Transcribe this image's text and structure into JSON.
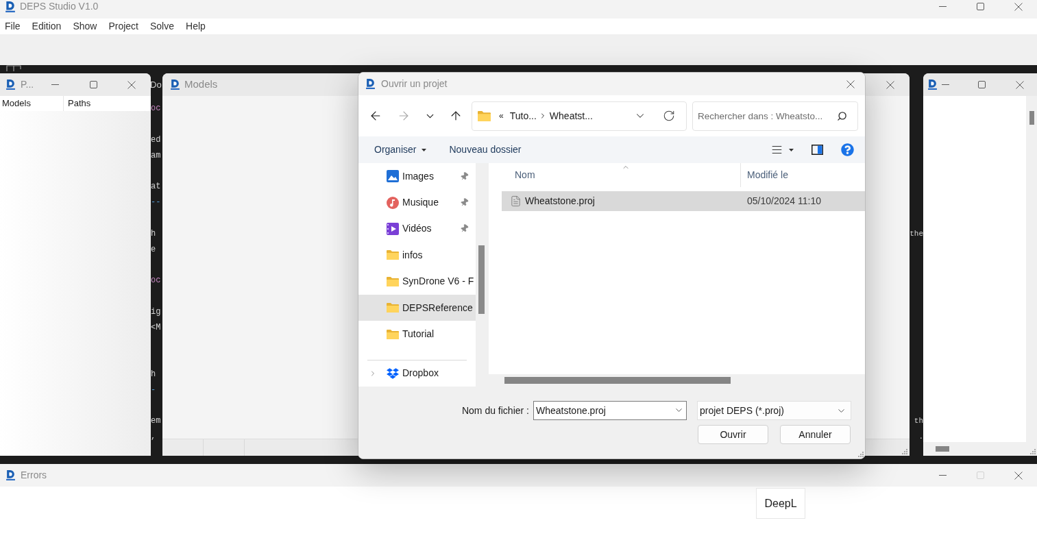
{
  "app_window": {
    "title": "DEPS Studio V1.0",
    "menu": [
      "File",
      "Edition",
      "Show",
      "Project",
      "Solve",
      "Help"
    ]
  },
  "editor": {
    "title": "Do",
    "lines": [
      {
        "kind": "code",
        "left": "oc",
        "color": "#c586c0"
      },
      {
        "kind": "blank"
      },
      {
        "kind": "code",
        "left": "ed"
      },
      {
        "kind": "code",
        "left": "am"
      },
      {
        "kind": "blank"
      },
      {
        "kind": "code",
        "left": "at"
      },
      {
        "kind": "code",
        "left": "--",
        "color": "#569cd6"
      },
      {
        "kind": "blank"
      },
      {
        "kind": "code",
        "left": "h",
        "right": "the"
      },
      {
        "kind": "code",
        "left": "e"
      },
      {
        "kind": "blank"
      },
      {
        "kind": "code",
        "left": "oc",
        "color": "#c586c0"
      },
      {
        "kind": "blank"
      },
      {
        "kind": "code",
        "left": "ig"
      },
      {
        "kind": "code",
        "left": "<M"
      },
      {
        "kind": "blank"
      },
      {
        "kind": "blank"
      },
      {
        "kind": "code",
        "left": "h"
      },
      {
        "kind": "code",
        "left": "-",
        "color": "#569cd6"
      },
      {
        "kind": "blank"
      },
      {
        "kind": "code",
        "left": "em",
        "right": "th"
      },
      {
        "kind": "code",
        "left": ",",
        "right": "."
      }
    ]
  },
  "windows": [
    {
      "kind": "columns",
      "title": "P...",
      "columns": [
        "Models",
        "Paths"
      ]
    },
    {
      "kind": "grid",
      "title": "Models"
    },
    {
      "kind": "scroll"
    }
  ],
  "dialog": {
    "title": "Ouvrir un projet",
    "nav_buttons": [
      {
        "kind": "back",
        "disabled": false
      },
      {
        "kind": "forward",
        "disabled": true
      },
      {
        "kind": "recent",
        "disabled": false
      },
      {
        "kind": "up",
        "disabled": false
      }
    ],
    "address": {
      "overflow": "«",
      "crumbs": [
        "Tuto...",
        "Wheatst..."
      ]
    },
    "search": {
      "placeholder": "Rechercher dans : Wheatsto..."
    },
    "toolbar": {
      "organize": "Organiser",
      "new_folder": "Nouveau dossier"
    },
    "nav_pane": {
      "quick_access": [
        {
          "label": "Images",
          "kind": "pictures",
          "pinned": true,
          "selected": false
        },
        {
          "label": "Musique",
          "kind": "music",
          "pinned": true,
          "selected": false
        },
        {
          "label": "Vidéos",
          "kind": "videos",
          "pinned": true,
          "selected": false
        },
        {
          "label": "infos",
          "kind": "folder",
          "pinned": false,
          "selected": false
        },
        {
          "label": "SynDrone V6 - F",
          "kind": "folder",
          "pinned": false,
          "selected": false
        },
        {
          "label": "DEPSReference",
          "kind": "folder",
          "pinned": false,
          "selected": true
        },
        {
          "label": "Tutorial",
          "kind": "folder",
          "pinned": false,
          "selected": false
        }
      ],
      "locations": [
        {
          "label": "Dropbox",
          "kind": "cloud",
          "expanded": false,
          "selected": false
        }
      ]
    },
    "files": {
      "columns": [
        {
          "label": "Nom",
          "sorted": true
        },
        {
          "label": "Modifié le",
          "sorted": false
        }
      ],
      "rows": [
        {
          "name": "Wheatstone.proj",
          "modified": "05/10/2024 11:10",
          "selected": true
        }
      ]
    },
    "footer": {
      "filename_label": "Nom du fichier :",
      "filename": "Wheatstone.proj",
      "filter": "projet DEPS (*.proj)",
      "buttons": [
        "Ouvrir",
        "Annuler"
      ]
    }
  },
  "errors_window": {
    "title": "Errors",
    "maximize_disabled": true
  },
  "popup_button": {
    "label": "DeepL"
  }
}
